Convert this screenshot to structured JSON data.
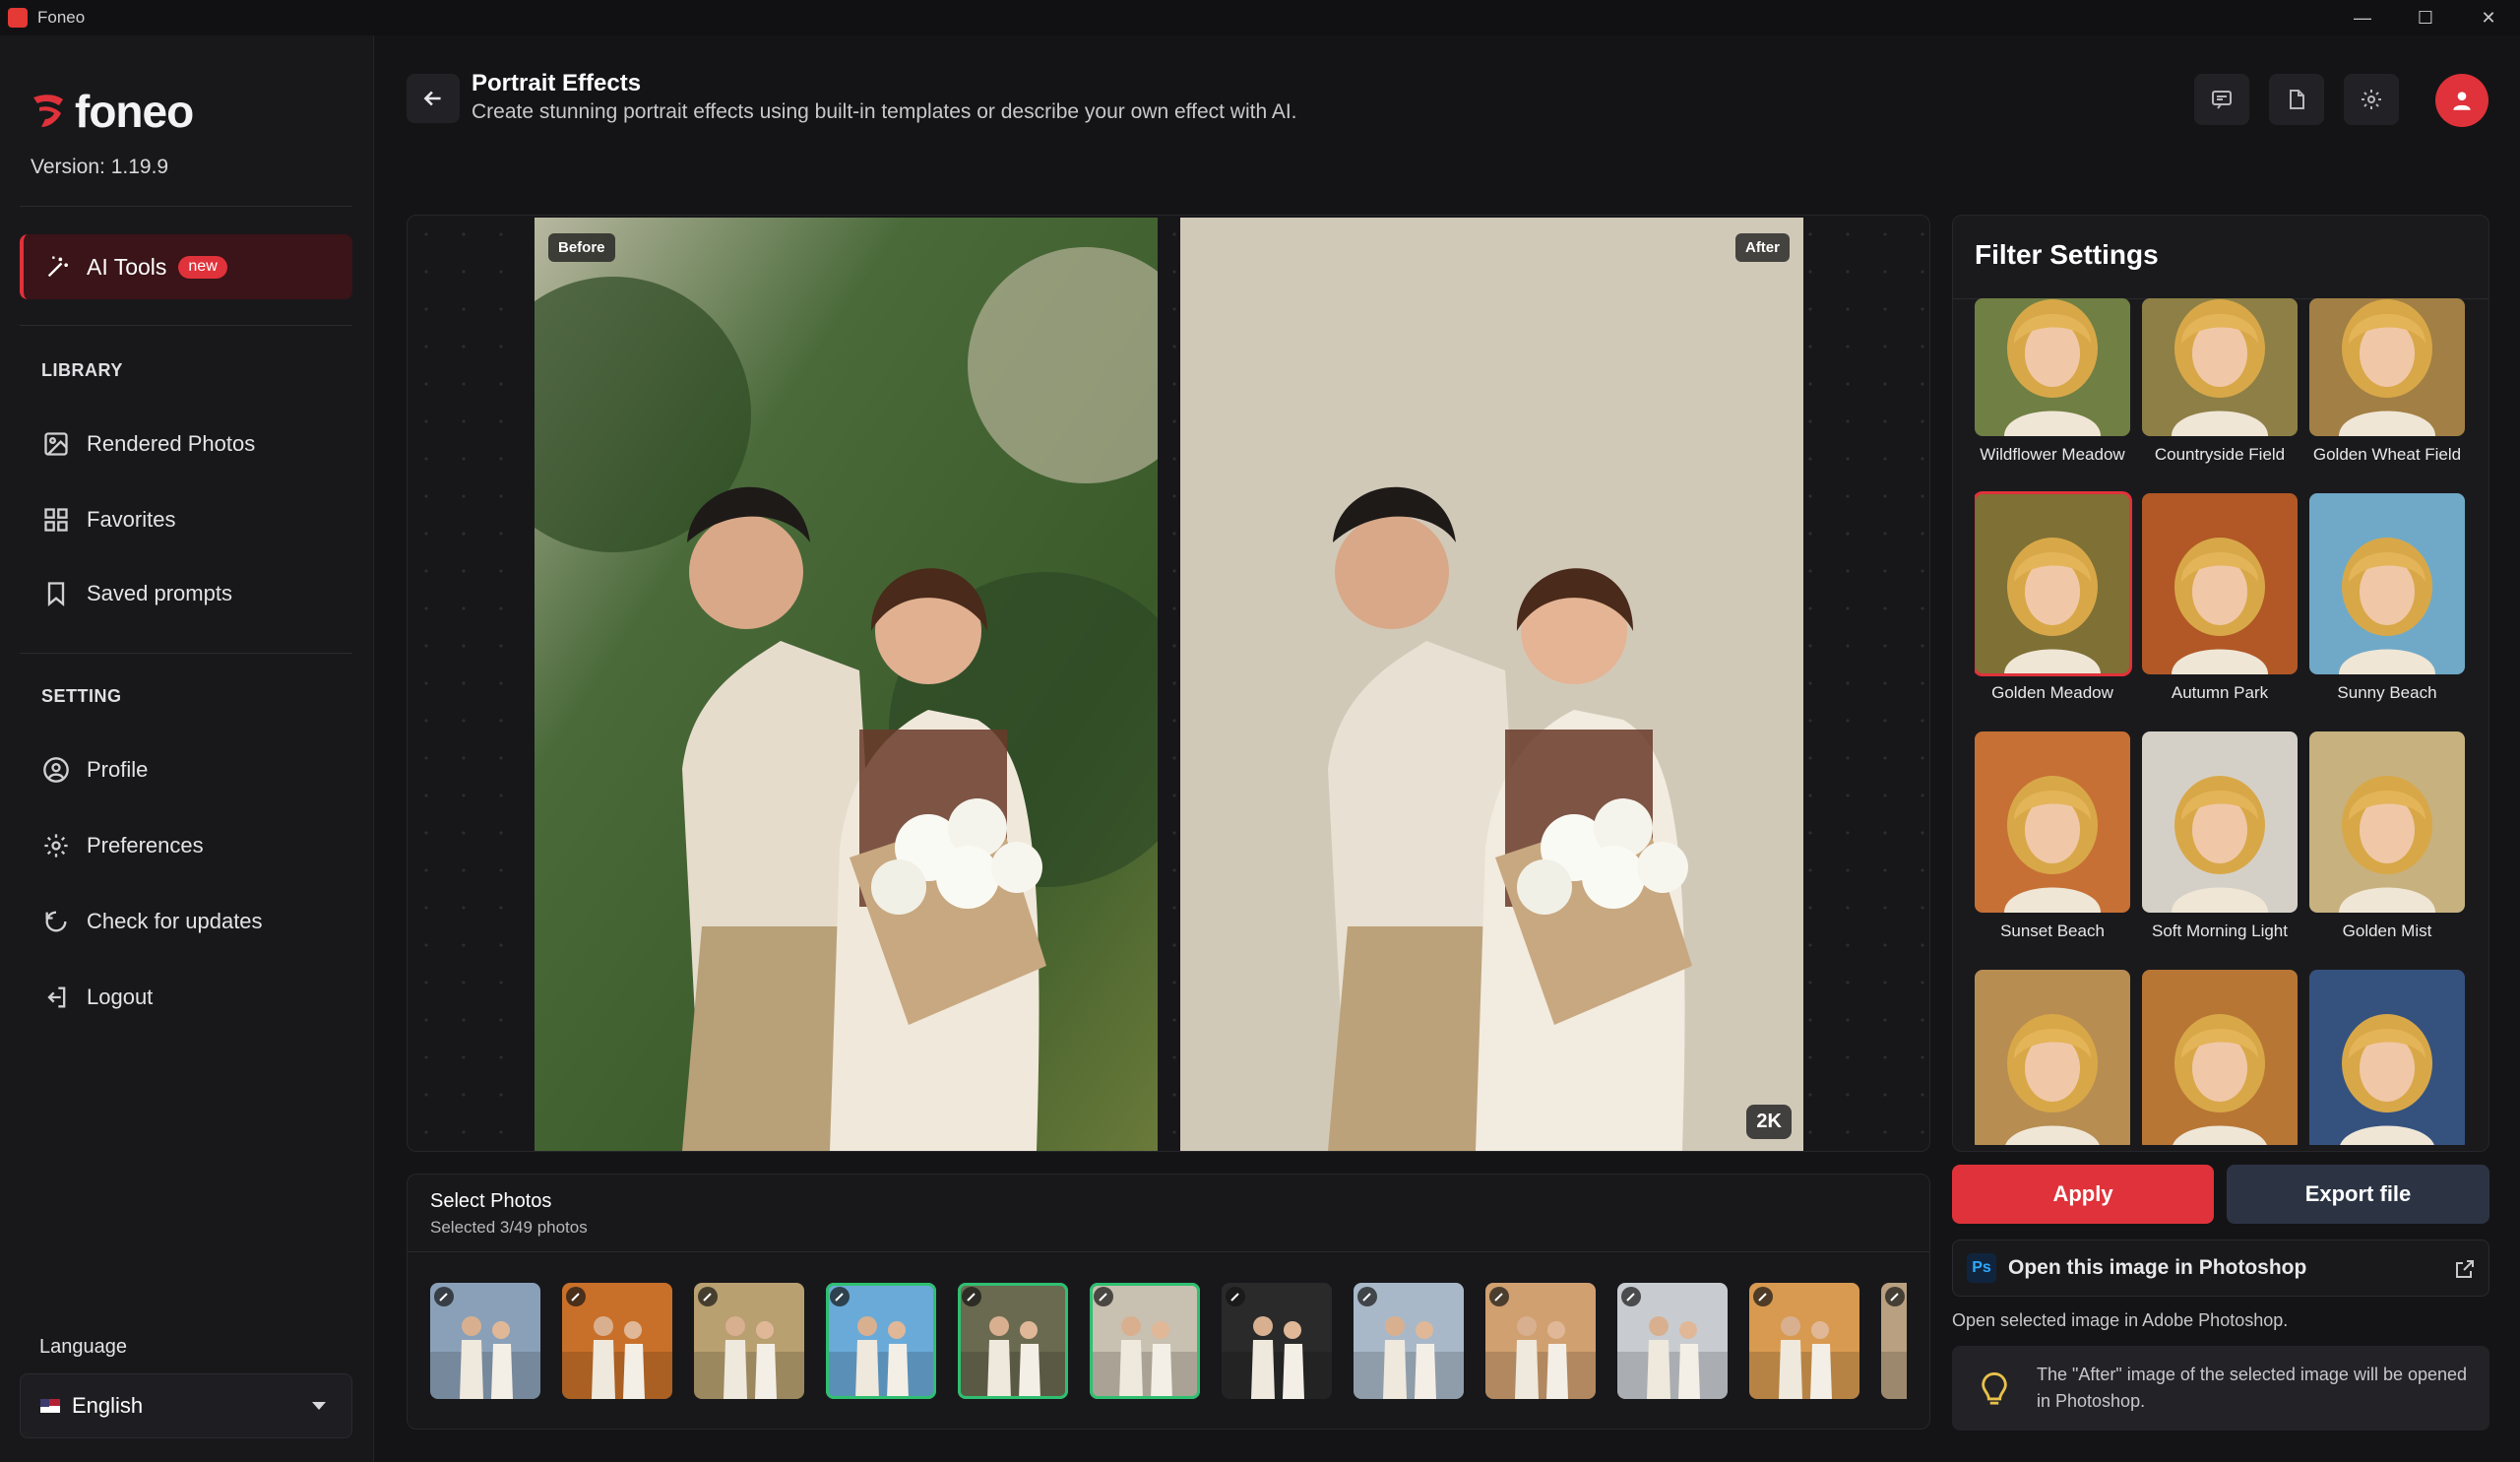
{
  "window": {
    "title": "Foneo",
    "controls": [
      "minimize",
      "maximize",
      "close"
    ]
  },
  "brand": {
    "name": "foneo",
    "version": "Version: 1.19.9",
    "accent": "#e0323a"
  },
  "sidebar": {
    "ai_tools": {
      "label": "AI Tools",
      "badge": "new"
    },
    "library_title": "LIBRARY",
    "library_items": [
      {
        "label": "Rendered Photos",
        "icon": "image-icon"
      },
      {
        "label": "Favorites",
        "icon": "grid-icon"
      },
      {
        "label": "Saved prompts",
        "icon": "bookmark-icon"
      }
    ],
    "setting_title": "SETTING",
    "setting_items": [
      {
        "label": "Profile",
        "icon": "user-circle-icon"
      },
      {
        "label": "Preferences",
        "icon": "gear-icon"
      },
      {
        "label": "Check for updates",
        "icon": "refresh-icon"
      },
      {
        "label": "Logout",
        "icon": "logout-icon"
      }
    ],
    "language_title": "Language",
    "language_value": "English"
  },
  "header": {
    "title": "Portrait Effects",
    "subtitle": "Create stunning portrait effects using built-in templates or describe your own effect with AI."
  },
  "canvas": {
    "before_label": "Before",
    "after_label": "After",
    "resolution_badge": "2K"
  },
  "filters": {
    "title": "Filter Settings",
    "selected": "Golden Meadow",
    "items": [
      {
        "label": "Wildflower Meadow",
        "bg": "#7a8a4a"
      },
      {
        "label": "Countryside Field",
        "bg": "#9a8a4c"
      },
      {
        "label": "Golden Wheat Field",
        "bg": "#b08a4a"
      },
      {
        "label": "Golden Meadow",
        "bg": "#8a7a3a"
      },
      {
        "label": "Autumn Park",
        "bg": "#c0602a"
      },
      {
        "label": "Sunny Beach",
        "bg": "#7ab8d8"
      },
      {
        "label": "Sunset Beach",
        "bg": "#d87a3a"
      },
      {
        "label": "Soft Morning Light",
        "bg": "#e8e2d8"
      },
      {
        "label": "Golden Mist",
        "bg": "#d8c08a"
      },
      {
        "label": "",
        "bg": "#c89a5a"
      },
      {
        "label": "",
        "bg": "#c8803a"
      },
      {
        "label": "",
        "bg": "#3a5a8a"
      }
    ]
  },
  "actions": {
    "apply": "Apply",
    "export": "Export file",
    "photoshop_icon": "Ps",
    "open_photoshop": "Open this image in Photoshop",
    "photoshop_help": "Open selected image in Adobe Photoshop.",
    "photoshop_note": "The \"After\" image of the selected image will be opened in Photoshop."
  },
  "select_photos": {
    "title": "Select Photos",
    "subtitle": "Selected 3/49 photos",
    "thumbs": [
      {
        "selected": false,
        "bg": "#8aa0b8"
      },
      {
        "selected": false,
        "bg": "#c8702a"
      },
      {
        "selected": false,
        "bg": "#b8a070"
      },
      {
        "selected": true,
        "bg": "#6aaad8"
      },
      {
        "selected": true,
        "bg": "#6a6a50"
      },
      {
        "selected": true,
        "bg": "#c8c0b0"
      },
      {
        "selected": false,
        "bg": "#2a2a2a"
      },
      {
        "selected": false,
        "bg": "#a8b8c8"
      },
      {
        "selected": false,
        "bg": "#d0a070"
      },
      {
        "selected": false,
        "bg": "#c8ccd0"
      },
      {
        "selected": false,
        "bg": "#d89a50"
      },
      {
        "selected": false,
        "bg": "#b8a080"
      }
    ]
  }
}
